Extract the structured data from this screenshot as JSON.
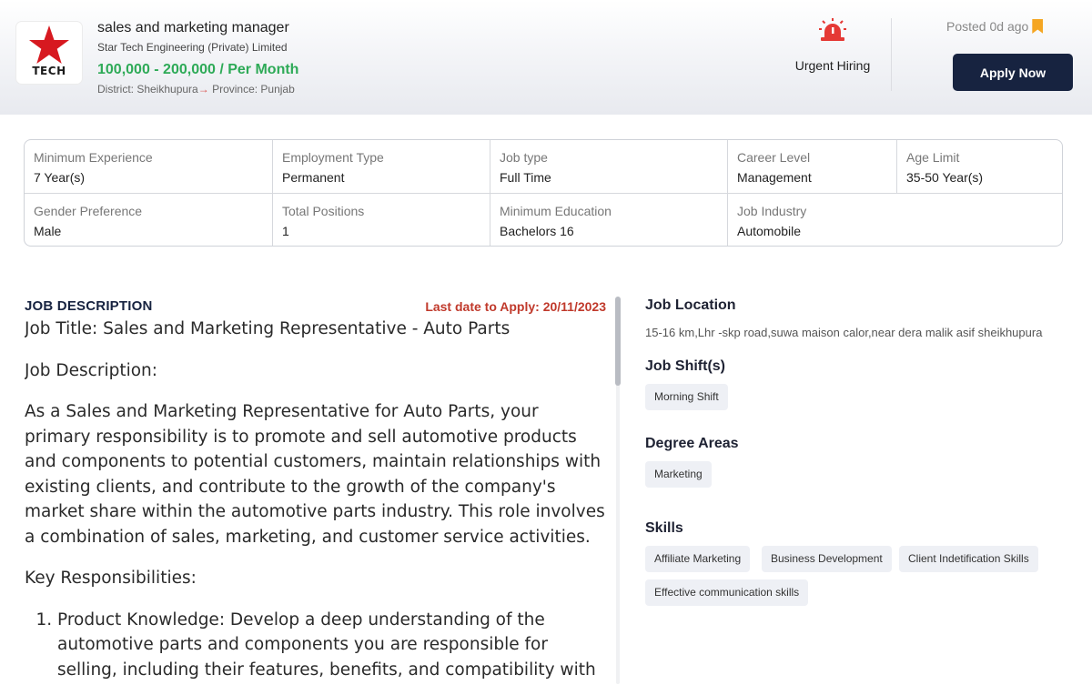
{
  "header": {
    "logo_text": "TECH",
    "job_title": "sales and marketing manager",
    "company": "Star Tech Engineering (Private) Limited",
    "salary": "100,000 - 200,000 / Per Month",
    "district": "District: Sheikhupura",
    "province": "Province: Punjab",
    "arrow": "→",
    "urgent_label": "Urgent Hiring",
    "posted": "Posted 0d ago",
    "apply_label": "Apply Now"
  },
  "details": [
    {
      "key": "Minimum Experience",
      "value": "7 Year(s)"
    },
    {
      "key": "Employment Type",
      "value": "Permanent"
    },
    {
      "key": "Job type",
      "value": "Full Time"
    },
    {
      "key": "Career Level",
      "value": "Management"
    },
    {
      "key": "Age Limit",
      "value": "35-50 Year(s)"
    },
    {
      "key": "Gender Preference",
      "value": "Male"
    },
    {
      "key": "Total Positions",
      "value": "1"
    },
    {
      "key": "Minimum Education",
      "value": "Bachelors 16"
    },
    {
      "key": "Job Industry",
      "value": "Automobile"
    }
  ],
  "description": {
    "heading": "JOB DESCRIPTION",
    "last_date": "Last date to Apply: 20/11/2023",
    "job_title_line": "Job Title: Sales and Marketing Representative - Auto Parts",
    "desc_label": "Job Description:",
    "paragraph": "As a Sales and Marketing Representative for Auto Parts, your primary responsibility is to promote and sell automotive products and components to potential customers, maintain relationships with existing clients, and contribute to the growth of the company's market share within the automotive parts industry. This role involves a combination of sales, marketing, and customer service activities.",
    "resp_label": "Key Responsibilities:",
    "responsibilities": [
      "Product Knowledge: Develop a deep understanding of the automotive parts and components you are responsible for selling, including their features, benefits, and compatibility with"
    ]
  },
  "sidebar": {
    "location_heading": "Job Location",
    "location_text": "15-16 km,Lhr -skp road,suwa maison calor,near dera malik asif sheikhupura",
    "shift_heading": "Job Shift(s)",
    "shifts": [
      "Morning Shift"
    ],
    "degree_heading": "Degree Areas",
    "degrees": [
      "Marketing"
    ],
    "skills_heading": "Skills",
    "skills": [
      "Affiliate Marketing",
      "Business Development",
      "Client Indetification Skills",
      "Effective communication skills"
    ]
  },
  "colors": {
    "accent_navy": "#172340",
    "salary_green": "#2eaa57",
    "deadline_red": "#c0392b",
    "bookmark_orange": "#f5a623",
    "alarm_red": "#e53935"
  },
  "icons": {
    "logo": "star-logo-icon",
    "urgent": "siren-icon",
    "posted": "bookmark-icon"
  }
}
